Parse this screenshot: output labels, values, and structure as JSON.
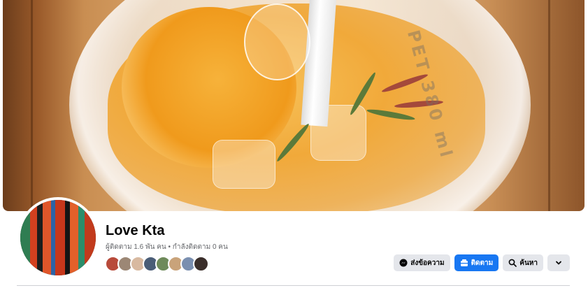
{
  "cover": {
    "lid_text": "PET 380 ml"
  },
  "profile": {
    "name": "Love Kta",
    "followers_line": "ผู้ติดตาม 1.6 พัน คน • กำลังติดตาม 0 คน",
    "friend_avatars": [
      "friend-1",
      "friend-2",
      "friend-3",
      "friend-4",
      "friend-5",
      "friend-6",
      "friend-7",
      "friend-8"
    ]
  },
  "actions": {
    "message_label": "ส่งข้อความ",
    "follow_label": "ติดตาม",
    "search_label": "ค้นหา",
    "more_icon": "chevron-down-icon",
    "message_icon": "messenger-icon",
    "follow_icon": "follow-icon",
    "search_icon": "search-icon"
  },
  "colors": {
    "primary": "#1877f2",
    "secondary_button": "#e4e6eb",
    "muted_text": "#65676b"
  }
}
